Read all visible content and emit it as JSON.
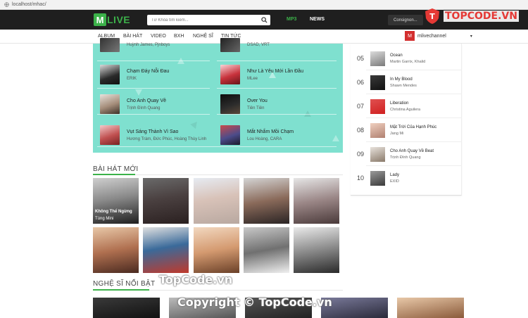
{
  "browser": {
    "url": "localhost/mhac/"
  },
  "header": {
    "logo_letter": "M",
    "logo_text": "LIVE",
    "search_placeholder": "Từ Khóa tìm kiếm...",
    "nav": [
      "MP3",
      "NEWS"
    ],
    "consign_label": "Consignon...",
    "brand_color": "#3cb24a"
  },
  "watermark": {
    "top": "TOPCODE.VN",
    "mid": "TopCode.vn",
    "bottom": "Copyright © TopCode.vn"
  },
  "subnav": {
    "items": [
      "ALBUM",
      "BÀI HÁT",
      "VIDEO",
      "BXH",
      "NGHỆ SĨ",
      "TIN TỨC"
    ],
    "channel_name": "mlivechannel",
    "channel_avatar_icon": "m-logo-icon",
    "dropdown_glyph": "▾"
  },
  "featured": {
    "left": [
      {
        "title": "",
        "artist": "Huỳnh James, Pjnboys"
      },
      {
        "title": "Chạm Đáy Nỗi Đau",
        "artist": "ERIK"
      },
      {
        "title": "Cho Anh Quay Về",
        "artist": "Trịnh Đình Quang"
      },
      {
        "title": "Vụt Sáng Thành Vì Sao",
        "artist": "Hương Tràm, Đức Phúc, Hoàng Thùy Linh"
      }
    ],
    "right": [
      {
        "title": "",
        "artist": "DSAD, VRT"
      },
      {
        "title": "Như Là Yêu Mới Lần Đầu",
        "artist": "MLee"
      },
      {
        "title": "Over You",
        "artist": "Tiên Tiên"
      },
      {
        "title": "Mắt Nhắm Mồi Chạm",
        "artist": "Lou Hoàng, CARA"
      }
    ]
  },
  "new_songs": {
    "heading": "BÀI HÁT MỚI",
    "first_caption": "Không Thể Ngừng",
    "first_sub": "Tùng Mini"
  },
  "artists": {
    "heading": "NGHỆ SĨ NỔI BẬT"
  },
  "ranking": [
    {
      "rank": "05",
      "title": "Ocean",
      "artist": "Martin Garrix, Khalid"
    },
    {
      "rank": "06",
      "title": "In My Blood",
      "artist": "Shawn Mendes"
    },
    {
      "rank": "07",
      "title": "Liberation",
      "artist": "Christina Aguilera"
    },
    {
      "rank": "08",
      "title": "Mặt Trời Của Hạnh Phúc",
      "artist": "Jang Mi"
    },
    {
      "rank": "09",
      "title": "Cho Anh Quay Về Beat",
      "artist": "Trịnh Đình Quang"
    },
    {
      "rank": "10",
      "title": "Lady",
      "artist": "EXID"
    }
  ]
}
